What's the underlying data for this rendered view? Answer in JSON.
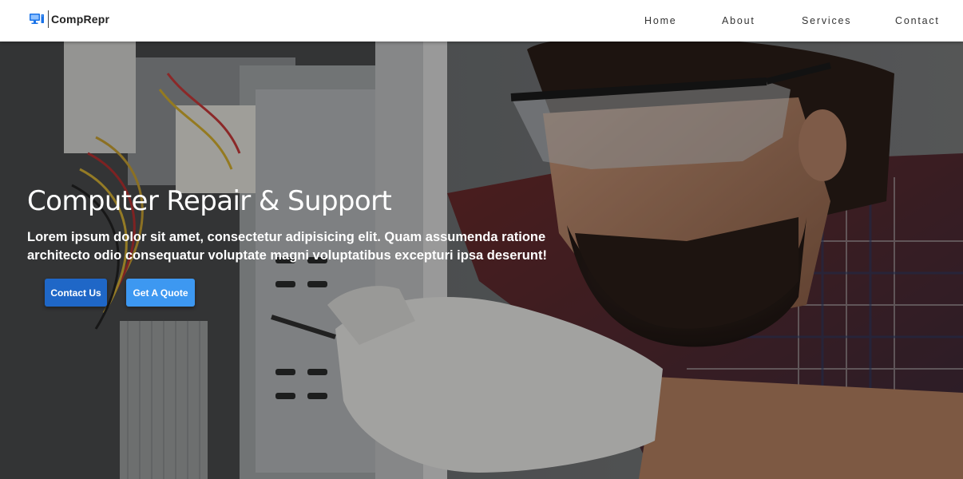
{
  "brand": {
    "name": "CompRepr",
    "icon": "computer-monitor-icon",
    "icon_color": "#1a73e8"
  },
  "nav": {
    "items": [
      {
        "label": "Home"
      },
      {
        "label": "About"
      },
      {
        "label": "Services"
      },
      {
        "label": "Contact"
      }
    ]
  },
  "hero": {
    "title": "Computer Repair & Support",
    "description": "Lorem ipsum dolor sit amet, consectetur adipisicing elit. Quam assumenda ratione architecto odio consequatur voluptate magni voluptatibus excepturi ipsa deserunt!",
    "background_image": "technician-repairing-computer-photo",
    "buttons": {
      "contact_label": "Contact Us",
      "quote_label": "Get A Quote"
    }
  },
  "colors": {
    "primary_button": "#1f67c7",
    "secondary_button": "#3d98f1",
    "navbar_bg": "#ffffff"
  }
}
